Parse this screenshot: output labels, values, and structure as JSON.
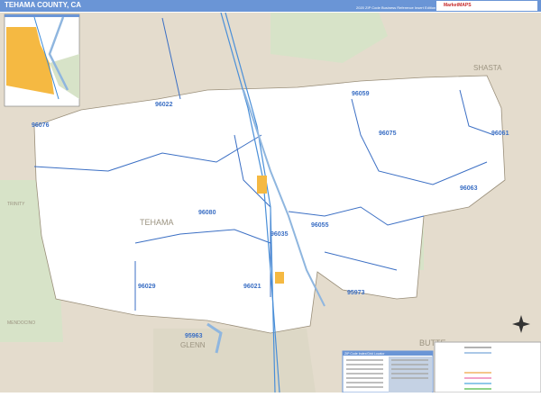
{
  "header": {
    "title": "TEHAMA COUNTY, CA",
    "edition": "2020 ZIP Code Business Reference Insert Edition",
    "logo": "MarketMAPS"
  },
  "map": {
    "zip_labels": [
      "96022",
      "96076",
      "96059",
      "96075",
      "96061",
      "96063",
      "96080",
      "96055",
      "96035",
      "96021",
      "95973",
      "96029",
      "95963"
    ],
    "county_labels": [
      "TEHAMA",
      "SHASTA",
      "TRINITY",
      "MENDOCINO",
      "GLENN",
      "BUTTE"
    ],
    "colors": {
      "county": "#ffffff",
      "outside": "#e4dccd",
      "forest": "#d7e3c8",
      "zip_line": "#3b6fc4",
      "city": "#f5b942",
      "water": "#8fb6df"
    }
  },
  "legend": {
    "header": "ZIP Code Index/Grid Locator"
  }
}
